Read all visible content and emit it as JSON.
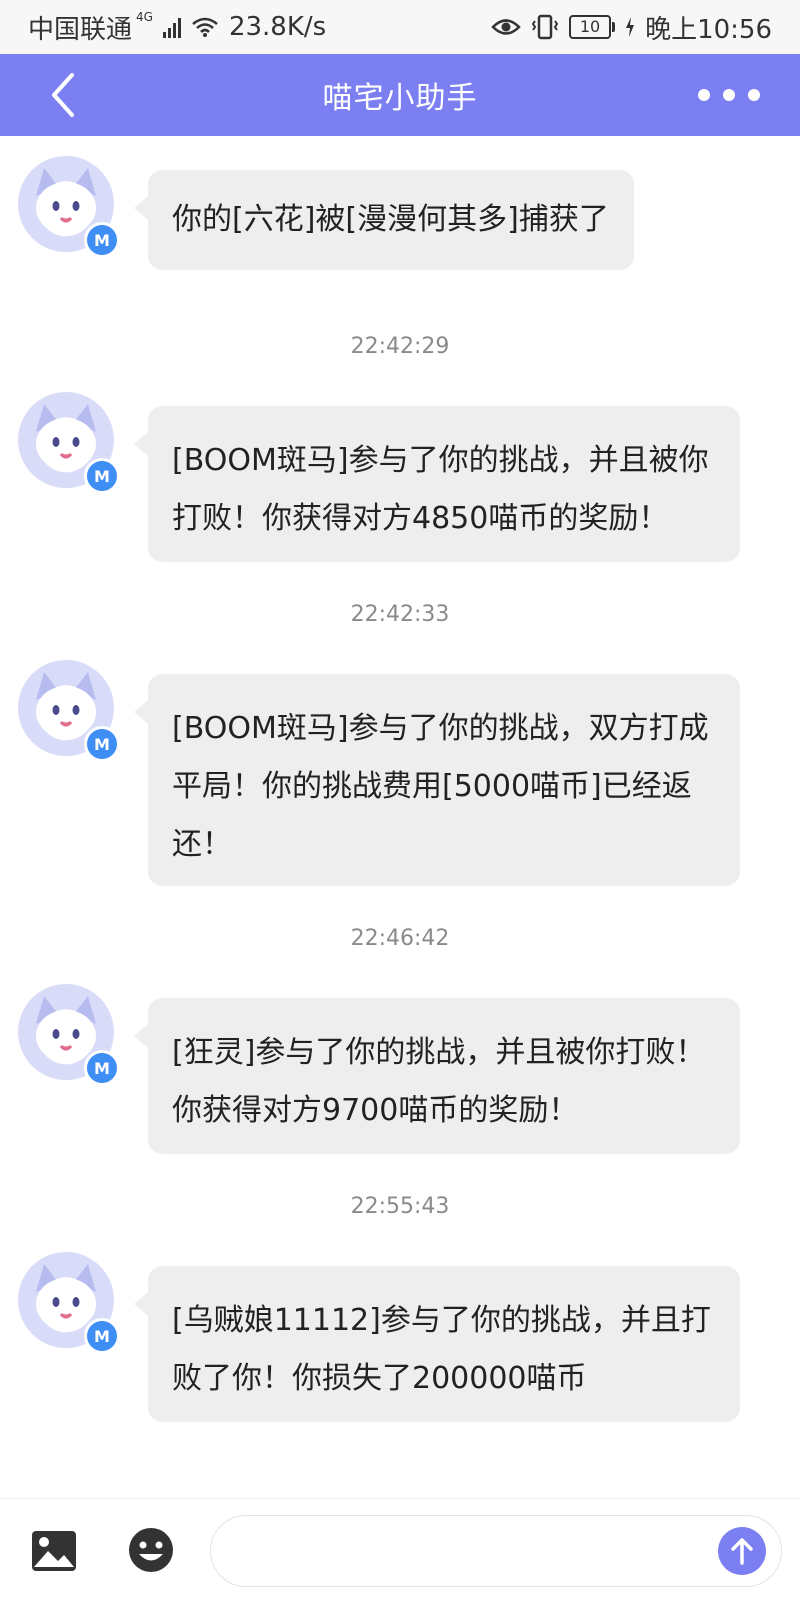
{
  "status_bar": {
    "carrier": "中国联通",
    "network": "4G",
    "speed": "23.8K/s",
    "battery": "10",
    "time": "晚上10:56",
    "icons": [
      "signal-icon",
      "wifi-icon",
      "eye-icon",
      "vibrate-icon",
      "battery-icon",
      "charging-icon"
    ]
  },
  "header": {
    "title": "喵宅小助手",
    "back_icon": "chevron-left-icon",
    "more_icon": "more-dots-icon",
    "color": "#7b7ff2"
  },
  "messages": [
    {
      "text": "你的[六花]被[漫漫何其多]捕获了",
      "badge": "M"
    },
    {
      "time": "22:42:29",
      "text": "[BOOM斑马]参与了你的挑战，并且被你打败！你获得对方4850喵币的奖励！",
      "badge": "M"
    },
    {
      "time": "22:42:33",
      "text": "[BOOM斑马]参与了你的挑战，双方打成平局！你的挑战费用[5000喵币]已经返还！",
      "badge": "M"
    },
    {
      "time": "22:46:42",
      "text": "[狂灵]参与了你的挑战，并且被你打败！你获得对方9700喵币的奖励！",
      "badge": "M"
    },
    {
      "time": "22:55:43",
      "text": "[乌贼娘11112]参与了你的挑战，并且打败了你！你损失了200000喵币",
      "badge": "M"
    }
  ],
  "bottom_bar": {
    "image_icon": "image-icon",
    "emoji_icon": "emoji-icon",
    "input_value": "",
    "input_placeholder": "",
    "send_icon": "send-arrow-icon"
  }
}
